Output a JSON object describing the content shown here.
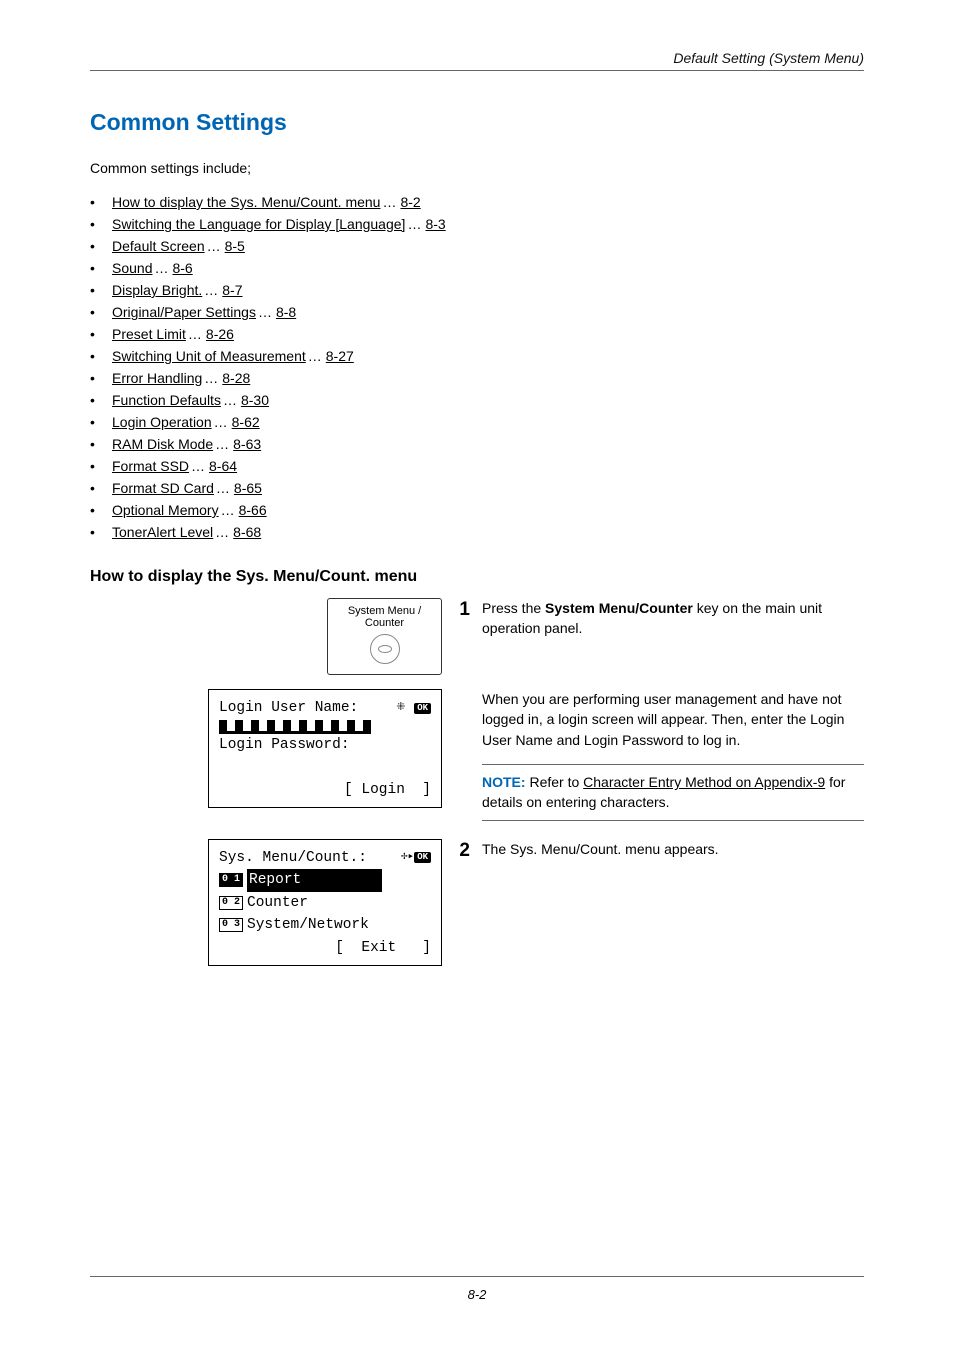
{
  "header": {
    "right": "Default Setting (System Menu)"
  },
  "title": "Common Settings",
  "intro": "Common settings include;",
  "toc": [
    {
      "label": "How to display the Sys. Menu/Count. menu",
      "page": "8-2"
    },
    {
      "label": "Switching the Language for Display [Language]",
      "page": "8-3"
    },
    {
      "label": "Default Screen",
      "page": "8-5"
    },
    {
      "label": "Sound",
      "page": "8-6"
    },
    {
      "label": "Display Bright.",
      "page": "8-7"
    },
    {
      "label": "Original/Paper Settings",
      "page": "8-8"
    },
    {
      "label": "Preset Limit",
      "page": "8-26"
    },
    {
      "label": "Switching Unit of Measurement",
      "page": "8-27"
    },
    {
      "label": "Error Handling",
      "page": "8-28"
    },
    {
      "label": "Function Defaults",
      "page": "8-30"
    },
    {
      "label": "Login Operation",
      "page": "8-62"
    },
    {
      "label": "RAM Disk Mode",
      "page": "8-63"
    },
    {
      "label": "Format SSD",
      "page": "8-64"
    },
    {
      "label": "Format SD Card",
      "page": "8-65"
    },
    {
      "label": "Optional Memory",
      "page": "8-66"
    },
    {
      "label": "TonerAlert Level",
      "page": "8-68"
    }
  ],
  "subheading": "How to display the Sys. Menu/Count. menu",
  "key_graphic_label": "System Menu / Counter",
  "steps": {
    "s1_num": "1",
    "s1_pre": "Press the ",
    "s1_bold": "System Menu/Counter",
    "s1_post": " key on the main unit operation panel.",
    "s1b_text": "When you are performing user management and have not logged in, a login screen will appear. Then, enter the Login User Name and Login Password to log in.",
    "s2_num": "2",
    "s2_text": "The Sys. Menu/Count. menu appears."
  },
  "lcd_login": {
    "line1": "Login User Name:",
    "ok": "OK",
    "line3": "Login Password:",
    "softkey": "[ Login  ]"
  },
  "lcd_menu": {
    "title": "Sys. Menu/Count.:",
    "ok": "OK",
    "items": [
      {
        "num": "0 1",
        "label": "Report",
        "selected": true
      },
      {
        "num": "0 2",
        "label": "Counter",
        "selected": false
      },
      {
        "num": "0 3",
        "label": "System/Network",
        "selected": false
      }
    ],
    "softkey": "[  Exit   ]"
  },
  "note": {
    "label": "NOTE:",
    "pre": " Refer to ",
    "link": "Character Entry Method on Appendix-9",
    "post": " for details on entering characters."
  },
  "footer_page": "8-2"
}
